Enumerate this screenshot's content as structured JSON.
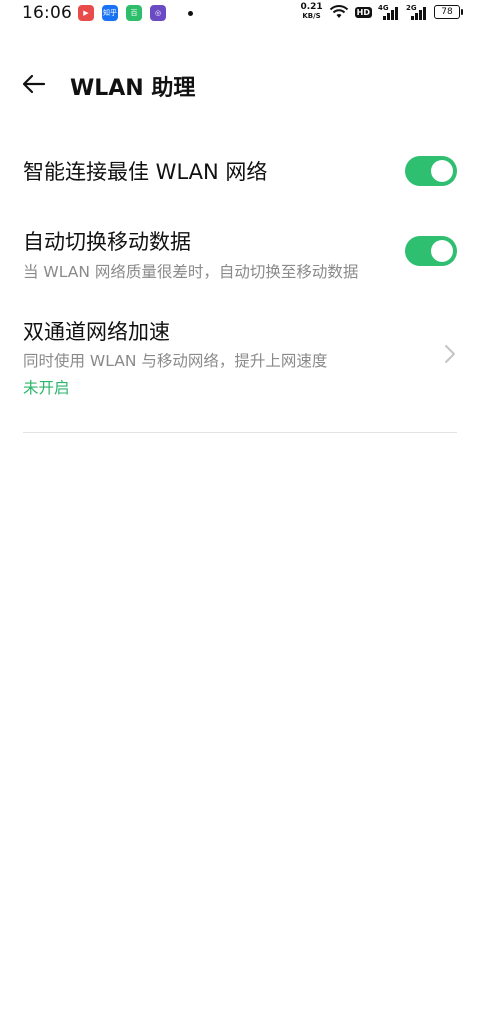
{
  "status_bar": {
    "time": "16:06",
    "net_speed_value": "0.21",
    "net_speed_unit": "KB/S",
    "hd_label": "HD",
    "sim1_label": "4G",
    "sim2_label": "2G",
    "battery": "78",
    "app_icons": [
      {
        "name": "app-icon-red",
        "color": "#e94a4a",
        "text": "▶"
      },
      {
        "name": "zhihu-icon",
        "color": "#1772f6",
        "text": "知乎"
      },
      {
        "name": "app-icon-green",
        "color": "#2ebd6b",
        "text": "百"
      },
      {
        "name": "app-icon-purple",
        "color": "#6a4bc4",
        "text": "◎"
      }
    ]
  },
  "header": {
    "title": "WLAN 助理"
  },
  "settings": {
    "smart_connect": {
      "title": "智能连接最佳 WLAN 网络",
      "enabled": true
    },
    "auto_switch": {
      "title": "自动切换移动数据",
      "subtitle": "当 WLAN 网络质量很差时，自动切换至移动数据",
      "enabled": true
    },
    "dual_channel": {
      "title": "双通道网络加速",
      "subtitle": "同时使用 WLAN 与移动网络，提升上网速度",
      "status": "未开启"
    }
  },
  "colors": {
    "accent": "#2fbf71",
    "status_green": "#2bb66a",
    "secondary_text": "#8a8a8a"
  }
}
